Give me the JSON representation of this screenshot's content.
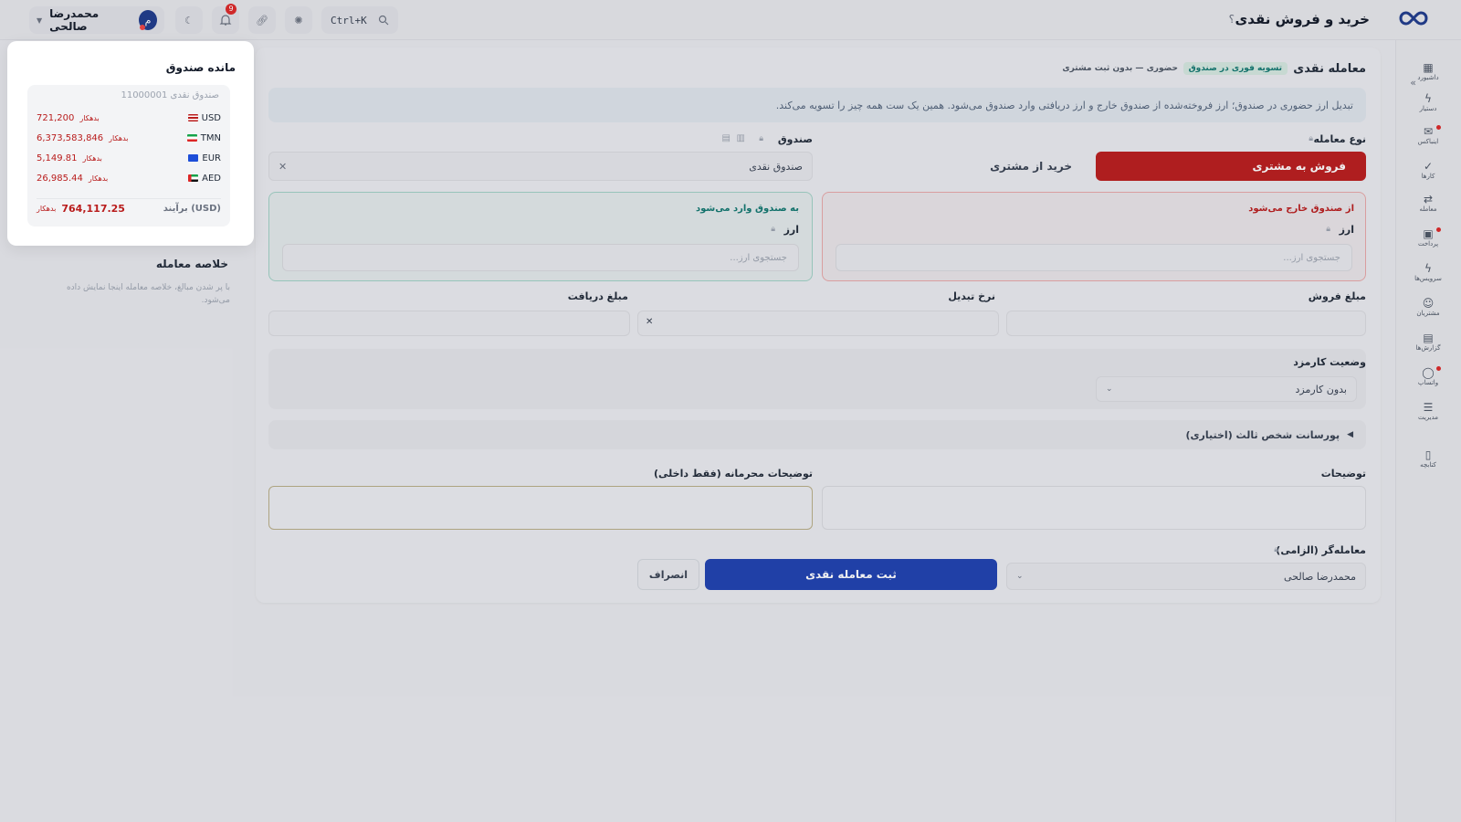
{
  "header": {
    "page_title": "خرید و فروش نقدی",
    "help": "؟",
    "search_shortcut": "Ctrl+K",
    "notifications_count": "9",
    "user_name": "محمدرضا صالحی",
    "user_initial": "م"
  },
  "sidebar": {
    "collapse": "«",
    "items": [
      {
        "label": "داشبورد",
        "icon": "▦"
      },
      {
        "label": "دستیار",
        "icon": "ϟ"
      },
      {
        "label": "اینباکس",
        "icon": "✉"
      },
      {
        "label": "کارها",
        "icon": "✓"
      },
      {
        "label": "معامله",
        "icon": "⇄"
      },
      {
        "label": "پرداخت",
        "icon": "▣"
      },
      {
        "label": "سرویس‌ها",
        "icon": "ϟ"
      },
      {
        "label": "مشتریان",
        "icon": "☺"
      },
      {
        "label": "گزارش‌ها",
        "icon": "▤"
      },
      {
        "label": "واتساپ",
        "icon": "◯"
      },
      {
        "label": "مدیریت",
        "icon": "☰"
      },
      {
        "label": "کتابچه",
        "icon": "▯"
      }
    ]
  },
  "form": {
    "section_title": "معامله نقدی",
    "tag_settle": "تسویه فوری در صندوق",
    "tag_mode": "حضوری — بدون ثبت مشتری",
    "banner": "تبدیل ارز حضوری در صندوق؛ ارز فروخته‌شده از صندوق خارج و ارز دریافتی وارد صندوق می‌شود. همین یک ست همه چیز را تسویه می‌کند.",
    "trade_type_label": "نوع معامله",
    "sell_btn": "فروش به مشتری",
    "buy_btn": "خرید از مشتری",
    "fund_label": "صندوق",
    "fund_value": "صندوق نقدی",
    "out_title": "از صندوق خارج می‌شود",
    "in_title": "به صندوق وارد می‌شود",
    "currency_label": "ارز",
    "currency_search_placeholder": "جستجوی ارز...",
    "sell_amount_label": "مبلغ فروش",
    "rate_label": "نرخ تبدیل",
    "receive_amount_label": "مبلغ دریافت",
    "fee_status_label": "وضعیت کارمزد",
    "fee_status_value": "بدون کارمزد",
    "third_party_label": "پورسانت شخص ثالث (اختیاری)",
    "notes_label": "توضیحات",
    "private_notes_label": "توضیحات محرمانه (فقط داخلی)",
    "dealer_label": "معامله‌گر (الزامی)",
    "dealer_value": "محمدرضا صالحی",
    "submit": "ثبت معامله نقدی",
    "cancel": "انصراف"
  },
  "summary": {
    "title": "خلاصه معامله",
    "text": "با پر شدن مبالغ، خلاصه معامله اینجا نمایش داده می‌شود."
  },
  "balance": {
    "title": "مانده صندوق",
    "fund_name": "صندوق نقدی 11000001",
    "debt_label": "بدهکار",
    "rows": [
      {
        "code": "USD",
        "amount": "721,200",
        "flag": "us"
      },
      {
        "code": "TMN",
        "amount": "6,373,583,846",
        "flag": "ir"
      },
      {
        "code": "EUR",
        "amount": "5,149.81",
        "flag": "eu"
      },
      {
        "code": "AED",
        "amount": "26,985.44",
        "flag": "ae"
      }
    ],
    "total_label": "برآیند (USD)",
    "total_amount": "764,117.25"
  },
  "colors": {
    "danger": "#b91c1c",
    "primary": "#1e40af",
    "success": "#0f766e"
  }
}
